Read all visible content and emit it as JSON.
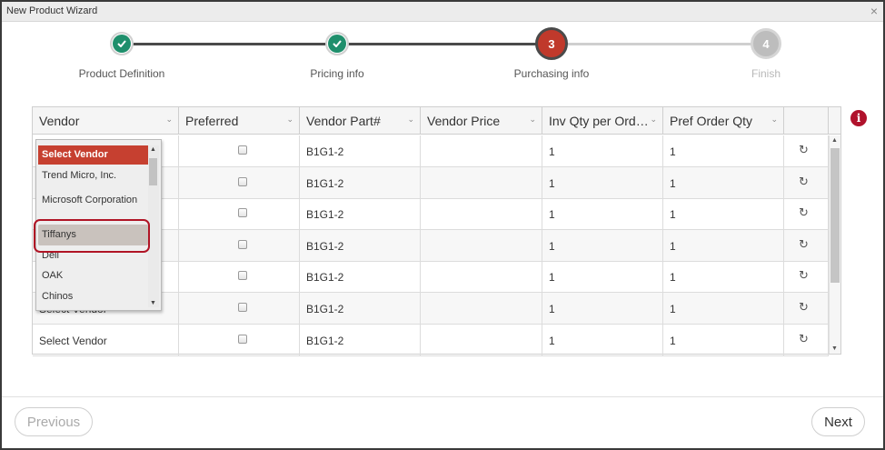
{
  "window": {
    "title": "New Product Wizard",
    "close_glyph": "×"
  },
  "steps": [
    {
      "label": "Product Definition",
      "state": "done",
      "number": ""
    },
    {
      "label": "Pricing info",
      "state": "done",
      "number": ""
    },
    {
      "label": "Purchasing info",
      "state": "active",
      "number": "3"
    },
    {
      "label": "Finish",
      "state": "future",
      "number": "4"
    }
  ],
  "grid": {
    "columns": [
      "Vendor",
      "Preferred",
      "Vendor Part#",
      "Vendor Price",
      "Inv Qty per Ord…",
      "Pref Order Qty"
    ],
    "rows": [
      {
        "vendor": "Select Vendor",
        "preferred": false,
        "part": "B1G1-2",
        "price": "",
        "inv_qty": "1",
        "pref_qty": "1"
      },
      {
        "vendor": "Select Vendor",
        "preferred": false,
        "part": "B1G1-2",
        "price": "",
        "inv_qty": "1",
        "pref_qty": "1"
      },
      {
        "vendor": "Select Vendor",
        "preferred": false,
        "part": "B1G1-2",
        "price": "",
        "inv_qty": "1",
        "pref_qty": "1"
      },
      {
        "vendor": "Select Vendor",
        "preferred": false,
        "part": "B1G1-2",
        "price": "",
        "inv_qty": "1",
        "pref_qty": "1"
      },
      {
        "vendor": "Select Vendor",
        "preferred": false,
        "part": "B1G1-2",
        "price": "",
        "inv_qty": "1",
        "pref_qty": "1"
      },
      {
        "vendor": "Select Vendor",
        "preferred": false,
        "part": "B1G1-2",
        "price": "",
        "inv_qty": "1",
        "pref_qty": "1"
      },
      {
        "vendor": "Select Vendor",
        "preferred": false,
        "part": "B1G1-2",
        "price": "",
        "inv_qty": "1",
        "pref_qty": "1"
      }
    ]
  },
  "vendor_dropdown": {
    "options": [
      "Select Vendor",
      "Trend Micro, Inc.",
      "Microsoft Corporation",
      "Tiffanys",
      "Dell",
      "OAK",
      "Chinos"
    ],
    "selected": "Select Vendor",
    "highlighted": "Tiffanys"
  },
  "info_icon": {
    "glyph": "i",
    "name": "info-icon"
  },
  "icons": {
    "refresh": "refresh-icon",
    "check": "check-icon"
  },
  "colors": {
    "done": "#1f8f6c",
    "active": "#c0392b",
    "future": "#bdbdbd",
    "error": "#b0122c"
  },
  "footer": {
    "previous_label": "Previous",
    "next_label": "Next"
  }
}
